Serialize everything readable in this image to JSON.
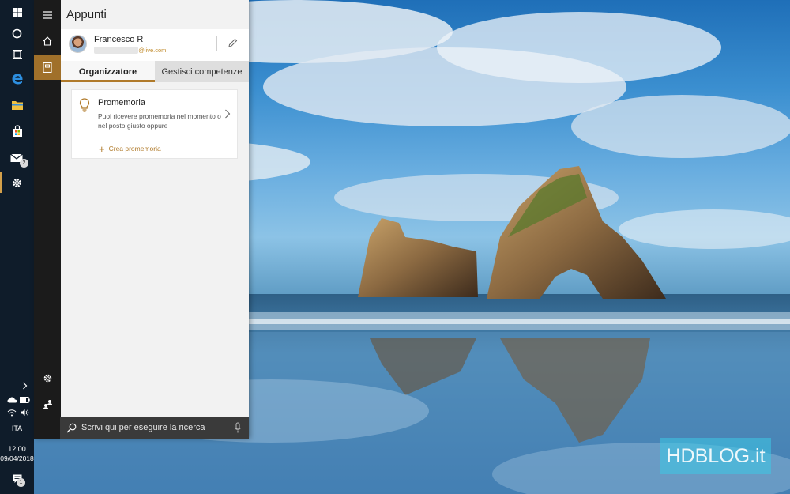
{
  "panel": {
    "title": "Appunti",
    "user": {
      "name": "Francesco R",
      "email_visible": "@live.com"
    },
    "tabs": [
      {
        "label": "Organizzatore",
        "selected": true
      },
      {
        "label": "Gestisci competenze",
        "selected": false
      }
    ],
    "card": {
      "title": "Promemoria",
      "description": "Puoi ricevere promemoria nel momento o nel posto giusto oppure",
      "action_label": "Crea promemoria"
    }
  },
  "search": {
    "placeholder": "Scrivi qui per eseguire la ricerca"
  },
  "taskbar": {
    "language": "ITA",
    "time": "12:00",
    "date": "09/04/2018",
    "mail_badge": "2",
    "notification_badge": "1"
  },
  "watermark": {
    "text": "HDBLOG.it"
  },
  "colors": {
    "accent": "#b07a2a",
    "taskbar": "#0f1c2a",
    "rail": "#1b1b1b",
    "panel": "#f2f2f2"
  }
}
